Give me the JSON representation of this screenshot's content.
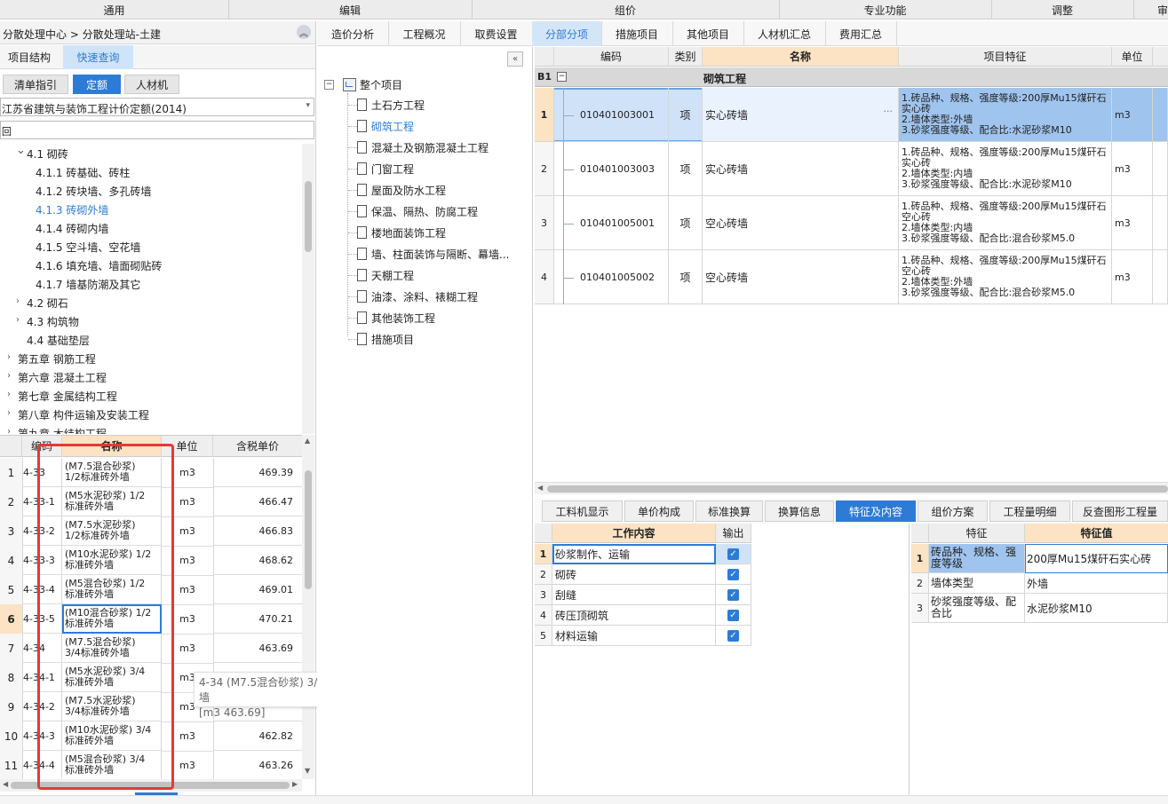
{
  "menu": [
    "通用",
    "编辑",
    "组价",
    "专业功能",
    "调整",
    "审"
  ],
  "left": {
    "breadcrumb": "分散处理中心 > 分散处理站-土建",
    "tabs_top": [
      "项目结构",
      "快速查询"
    ],
    "tabs_sub": [
      "清单指引",
      "定额",
      "人材机"
    ],
    "quota_select": "江苏省建筑与装饰工程计价定额(2014)",
    "search_value": "回",
    "tree": [
      {
        "label": "4.1 砌砖",
        "indent": 1,
        "arrow": "down"
      },
      {
        "label": "4.1.1 砖基础、砖柱",
        "indent": 2
      },
      {
        "label": "4.1.2 砖块墙、多孔砖墙",
        "indent": 2
      },
      {
        "label": "4.1.3 砖砌外墙",
        "indent": 2,
        "active": true
      },
      {
        "label": "4.1.4 砖砌内墙",
        "indent": 2
      },
      {
        "label": "4.1.5 空斗墙、空花墙",
        "indent": 2
      },
      {
        "label": "4.1.6 填充墙、墙面砌贴砖",
        "indent": 2
      },
      {
        "label": "4.1.7 墙基防潮及其它",
        "indent": 2
      },
      {
        "label": "4.2 砌石",
        "indent": 1,
        "arrow": "right"
      },
      {
        "label": "4.3 构筑物",
        "indent": 1,
        "arrow": "right"
      },
      {
        "label": "4.4 基础垫层",
        "indent": 1
      },
      {
        "label": "第五章 钢筋工程",
        "indent": 0,
        "arrow": "right"
      },
      {
        "label": "第六章 混凝土工程",
        "indent": 0,
        "arrow": "right"
      },
      {
        "label": "第七章 金属结构工程",
        "indent": 0,
        "arrow": "right"
      },
      {
        "label": "第八章 构件运输及安装工程",
        "indent": 0,
        "arrow": "right"
      },
      {
        "label": "第九章 木结构工程",
        "indent": 0,
        "arrow": "right"
      }
    ],
    "table_headers": [
      "编码",
      "名称",
      "单位",
      "含税单价"
    ],
    "rows": [
      {
        "no": "1",
        "code": "4-33",
        "name": "(M7.5混合砂浆)\n1/2标准砖外墙",
        "unit": "m3",
        "price": "469.39"
      },
      {
        "no": "2",
        "code": "4-33-1",
        "name": "(M5水泥砂浆) 1/2\n标准砖外墙",
        "unit": "m3",
        "price": "466.47"
      },
      {
        "no": "3",
        "code": "4-33-2",
        "name": "(M7.5水泥砂浆)\n1/2标准砖外墙",
        "unit": "m3",
        "price": "466.83"
      },
      {
        "no": "4",
        "code": "4-33-3",
        "name": "(M10水泥砂浆) 1/2\n标准砖外墙",
        "unit": "m3",
        "price": "468.62"
      },
      {
        "no": "5",
        "code": "4-33-4",
        "name": "(M5混合砂浆) 1/2\n标准砖外墙",
        "unit": "m3",
        "price": "469.01"
      },
      {
        "no": "6",
        "code": "4-33-5",
        "name": "(M10混合砂浆) 1/2\n标准砖外墙",
        "unit": "m3",
        "price": "470.21",
        "selected": true
      },
      {
        "no": "7",
        "code": "4-34",
        "name": "(M7.5混合砂浆)\n3/4标准砖外墙",
        "unit": "m3",
        "price": "463.69"
      },
      {
        "no": "8",
        "code": "4-34-1",
        "name": "(M5水泥砂浆) 3/4\n标准砖外墙",
        "unit": "m3",
        "price": ""
      },
      {
        "no": "9",
        "code": "4-34-2",
        "name": "(M7.5水泥砂浆)\n3/4标准砖外墙",
        "unit": "m3",
        "price": ""
      },
      {
        "no": "10",
        "code": "4-34-3",
        "name": "(M10水泥砂浆) 3/4\n标准砖外墙",
        "unit": "m3",
        "price": "462.82"
      },
      {
        "no": "11",
        "code": "4-34-4",
        "name": "(M5混合砂浆) 3/4\n标准砖外墙",
        "unit": "m3",
        "price": "463.26"
      }
    ],
    "tooltip_line1": "4-34 (M7.5混合砂浆) 3/4标准砖外墙",
    "tooltip_line2": "[m3 463.69]"
  },
  "main_tabs": [
    "造价分析",
    "工程概况",
    "取费设置",
    "分部分项",
    "措施项目",
    "其他项目",
    "人材机汇总",
    "费用汇总"
  ],
  "project_tree": {
    "root": "整个项目",
    "items": [
      "土石方工程",
      "砌筑工程",
      "混凝土及钢筋混凝土工程",
      "门窗工程",
      "屋面及防水工程",
      "保温、隔热、防腐工程",
      "楼地面装饰工程",
      "墙、柱面装饰与隔断、幕墙...",
      "天棚工程",
      "油漆、涂料、裱糊工程",
      "其他装饰工程",
      "措施项目"
    ]
  },
  "grid": {
    "headers": [
      "编码",
      "类别",
      "名称",
      "项目特征",
      "单位"
    ],
    "group_no": "B1",
    "group_name": "砌筑工程",
    "rows": [
      {
        "no": "1",
        "code": "010401003001",
        "type": "项",
        "name": "实心砖墙",
        "feature": "1.砖品种、规格、强度等级:200厚Mu15煤矸石实心砖\n2.墙体类型:外墙\n3.砂浆强度等级、配合比:水泥砂浆M10",
        "unit": "m3",
        "selected": true
      },
      {
        "no": "2",
        "code": "010401003003",
        "type": "项",
        "name": "实心砖墙",
        "feature": "1.砖品种、规格、强度等级:200厚Mu15煤矸石实心砖\n2.墙体类型:内墙\n3.砂浆强度等级、配合比:水泥砂浆M10",
        "unit": "m3"
      },
      {
        "no": "3",
        "code": "010401005001",
        "type": "项",
        "name": "空心砖墙",
        "feature": "1.砖品种、规格、强度等级:200厚Mu15煤矸石空心砖\n2.墙体类型:内墙\n3.砂浆强度等级、配合比:混合砂浆M5.0",
        "unit": "m3"
      },
      {
        "no": "4",
        "code": "010401005002",
        "type": "项",
        "name": "空心砖墙",
        "feature": "1.砖品种、规格、强度等级:200厚Mu15煤矸石空心砖\n2.墙体类型:外墙\n3.砂浆强度等级、配合比:混合砂浆M5.0",
        "unit": "m3"
      }
    ],
    "more_glyph": "···"
  },
  "bottom_tabs": [
    "工料机显示",
    "单价构成",
    "标准换算",
    "换算信息",
    "特征及内容",
    "组价方案",
    "工程量明细",
    "反查图形工程量"
  ],
  "work": {
    "headers": [
      "工作内容",
      "输出"
    ],
    "rows": [
      {
        "no": "1",
        "name": "砂浆制作、运输"
      },
      {
        "no": "2",
        "name": "砌砖"
      },
      {
        "no": "3",
        "name": "刮缝"
      },
      {
        "no": "4",
        "name": "砖压顶砌筑"
      },
      {
        "no": "5",
        "name": "材料运输"
      }
    ],
    "check_glyph": "✓"
  },
  "features": {
    "headers": [
      "特征",
      "特征值"
    ],
    "rows": [
      {
        "no": "1",
        "name": "砖品种、规格、强度等级",
        "value": "200厚Mu15煤矸石实心砖"
      },
      {
        "no": "2",
        "name": "墙体类型",
        "value": "外墙"
      },
      {
        "no": "3",
        "name": "砂浆强度等级、配合比",
        "value": "水泥砂浆M10"
      }
    ]
  },
  "colors": {
    "accent": "#2e7bd6",
    "header_bg": "#fbe3c4",
    "selected": "#b9d4f5",
    "highlight_box": "#e53935"
  }
}
